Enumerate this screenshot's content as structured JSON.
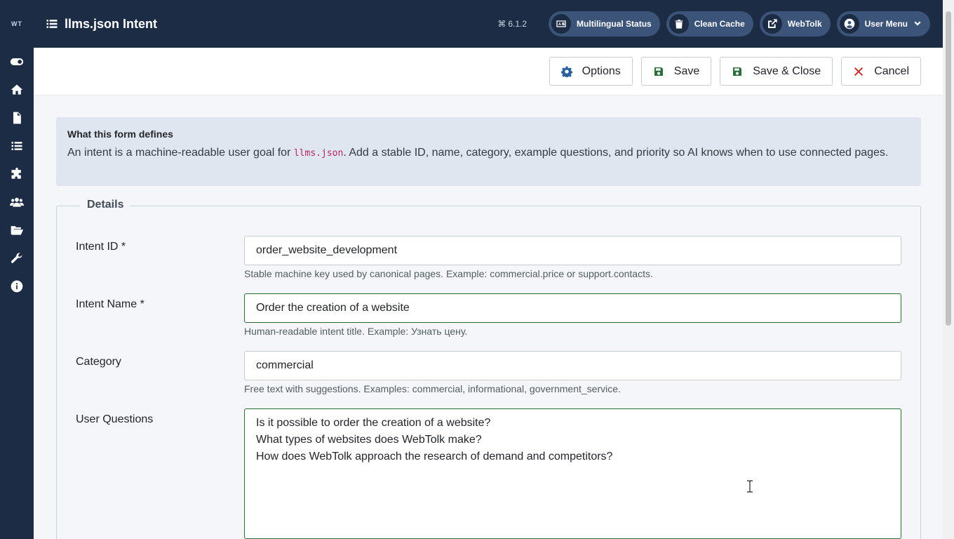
{
  "sidebar": {
    "logo": "WT",
    "items": [
      {
        "icon": "toggle-icon",
        "name": "sidebar-item-toggle"
      },
      {
        "icon": "home-icon",
        "name": "sidebar-item-home"
      },
      {
        "icon": "file-icon",
        "name": "sidebar-item-content"
      },
      {
        "icon": "list-icon",
        "name": "sidebar-item-menus"
      },
      {
        "icon": "puzzle-icon",
        "name": "sidebar-item-components"
      },
      {
        "icon": "users-icon",
        "name": "sidebar-item-users"
      },
      {
        "icon": "folder-icon",
        "name": "sidebar-item-system"
      },
      {
        "icon": "wrench-icon",
        "name": "sidebar-item-tools"
      },
      {
        "icon": "info-icon",
        "name": "sidebar-item-help"
      }
    ]
  },
  "header": {
    "title": "llms.json Intent",
    "version": "6.1.2",
    "buttons": {
      "multilingual": "Multilingual Status",
      "clean_cache": "Clean Cache",
      "site": "WebTolk",
      "user_menu": "User Menu"
    }
  },
  "toolbar": {
    "options": "Options",
    "save": "Save",
    "save_close": "Save & Close",
    "cancel": "Cancel"
  },
  "alert": {
    "title": "What this form defines",
    "text_before": "An intent is a machine-readable user goal for ",
    "code": "llms.json",
    "text_after": ". Add a stable ID, name, category, example questions, and priority so AI knows when to use connected pages."
  },
  "form": {
    "legend": "Details",
    "intent_id": {
      "label": "Intent ID *",
      "value": "order_website_development",
      "help": "Stable machine key used by canonical pages. Example: commercial.price or support.contacts."
    },
    "intent_name": {
      "label": "Intent Name *",
      "value": "Order the creation of a website",
      "help": "Human-readable intent title. Example: Узнать цену."
    },
    "category": {
      "label": "Category",
      "value": "commercial",
      "help": "Free text with suggestions. Examples: commercial, informational, government_service."
    },
    "user_questions": {
      "label": "User Questions",
      "lines": [
        "Is it possible to order the creation of a website?",
        "What types of websites does WebTolk make?",
        "How does WebTolk approach the research of demand and competitors?"
      ]
    }
  },
  "colors": {
    "sidebar_bg": "#1c2c44",
    "pill_bg": "#3b5478",
    "save_icon": "#2e6b3b",
    "cancel_icon": "#c52827",
    "options_icon": "#2a5f9e",
    "valid_border": "#2e6b3b"
  }
}
